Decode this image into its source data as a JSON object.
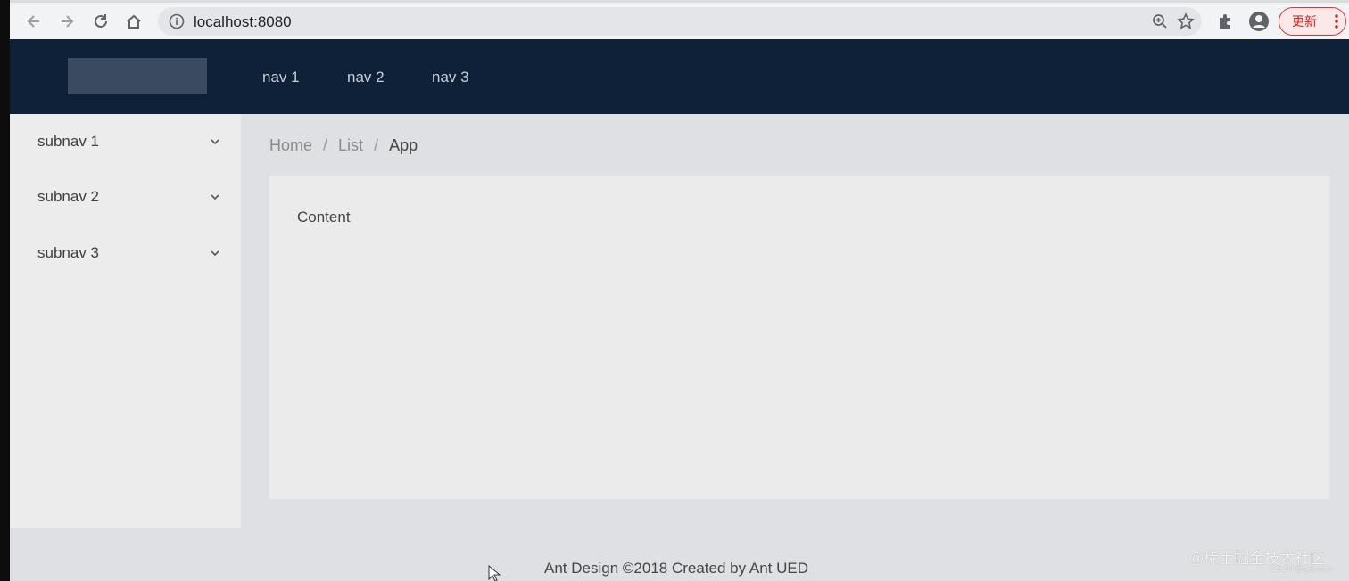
{
  "browser": {
    "url": "localhost:8080",
    "update_label": "更新"
  },
  "header": {
    "nav": [
      "nav 1",
      "nav 2",
      "nav 3"
    ]
  },
  "sider": {
    "items": [
      {
        "label": "subnav 1"
      },
      {
        "label": "subnav 2"
      },
      {
        "label": "subnav 3"
      }
    ]
  },
  "breadcrumb": {
    "items": [
      "Home",
      "List",
      "App"
    ],
    "separator": "/"
  },
  "content": {
    "text": "Content"
  },
  "footer": {
    "text": "Ant Design ©2018 Created by Ant UED"
  },
  "watermark": {
    "main": "@稀土掘金技术社区",
    "sub": "CSDN @gujunhe"
  },
  "colors": {
    "header_bg": "#0e2138",
    "page_bg": "#dfe0e3",
    "update_accent": "#d9383a"
  }
}
